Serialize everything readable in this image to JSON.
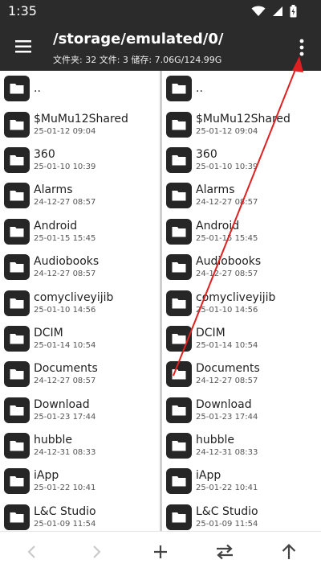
{
  "status_bar": {
    "time": "1:35"
  },
  "toolbar": {
    "path": "/storage/emulated/0/",
    "summary": "文件夹: 32  文件: 3  储存: 7.06G/124.99G"
  },
  "icons": {
    "menu": "hamburger-menu-icon",
    "more": "more-vert-icon",
    "folder": "folder-icon",
    "back": "chevron-left-icon",
    "forward": "chevron-right-icon",
    "add": "plus-icon",
    "swap": "swap-arrows-icon",
    "up": "arrow-up-icon"
  },
  "colors": {
    "bar": "#2b2b2b",
    "folder": "#262626",
    "annotation": "#e02020"
  },
  "left_pane": {
    "items": [
      {
        "name": "..",
        "date": ""
      },
      {
        "name": "$MuMu12Shared",
        "date": "25-01-12 09:04"
      },
      {
        "name": "360",
        "date": "25-01-10 10:39"
      },
      {
        "name": "Alarms",
        "date": "24-12-27 08:57"
      },
      {
        "name": "Android",
        "date": "25-01-15 15:45"
      },
      {
        "name": "Audiobooks",
        "date": "24-12-27 08:57"
      },
      {
        "name": "comycliveyijib",
        "date": "25-01-10 14:56"
      },
      {
        "name": "DCIM",
        "date": "25-01-14 10:54"
      },
      {
        "name": "Documents",
        "date": "24-12-27 08:57"
      },
      {
        "name": "Download",
        "date": "25-01-23 17:44"
      },
      {
        "name": "hubble",
        "date": "24-12-31 08:33"
      },
      {
        "name": "iApp",
        "date": "25-01-22 10:41"
      },
      {
        "name": "L&C Studio",
        "date": "25-01-09 11:54"
      }
    ]
  },
  "right_pane": {
    "items": [
      {
        "name": "..",
        "date": ""
      },
      {
        "name": "$MuMu12Shared",
        "date": "25-01-12 09:04"
      },
      {
        "name": "360",
        "date": "25-01-10 10:39"
      },
      {
        "name": "Alarms",
        "date": "24-12-27 08:57"
      },
      {
        "name": "Android",
        "date": "25-01-15 15:45"
      },
      {
        "name": "Audiobooks",
        "date": "24-12-27 08:57"
      },
      {
        "name": "comycliveyijib",
        "date": "25-01-10 14:56"
      },
      {
        "name": "DCIM",
        "date": "25-01-14 10:54"
      },
      {
        "name": "Documents",
        "date": "24-12-27 08:57"
      },
      {
        "name": "Download",
        "date": "25-01-23 17:44"
      },
      {
        "name": "hubble",
        "date": "24-12-31 08:33"
      },
      {
        "name": "iApp",
        "date": "25-01-22 10:41"
      },
      {
        "name": "L&C Studio",
        "date": "25-01-09 11:54"
      }
    ]
  }
}
